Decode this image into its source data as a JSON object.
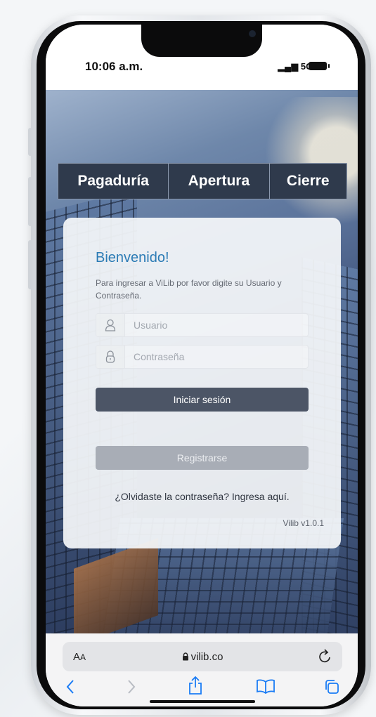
{
  "status": {
    "time": "10:06 a.m.",
    "network": "5G"
  },
  "nav": {
    "tabs": [
      {
        "label": "Pagaduría"
      },
      {
        "label": "Apertura"
      },
      {
        "label": "Cierre"
      }
    ]
  },
  "login": {
    "title": "Bienvenido!",
    "intro": "Para ingresar a ViLib por favor digite su Usuario y Contraseña.",
    "user_placeholder": "Usuario",
    "password_placeholder": "Contraseña",
    "login_label": "Iniciar sesión",
    "register_label": "Registrarse",
    "forgot_label": "¿Olvidaste la contraseña? Ingresa aquí.",
    "version": "Vilib v1.0.1"
  },
  "browser": {
    "aa_label_big": "A",
    "aa_label_small": "A",
    "url": "vilib.co",
    "icons": [
      "lock-icon",
      "reload-icon",
      "back-icon",
      "forward-icon",
      "share-icon",
      "bookmarks-icon",
      "tabs-icon"
    ]
  },
  "colors": {
    "nav_bg": "#2f3a4c",
    "title_blue": "#2b7bb5",
    "login_button": "#4c5566",
    "register_button": "#a8adb6",
    "ios_blue": "#1a7cf5"
  }
}
